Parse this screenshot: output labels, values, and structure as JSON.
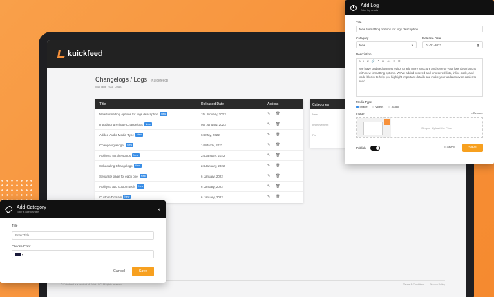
{
  "app": {
    "logo_text": "kuickfeed",
    "page_title": "Changelogs / Logs",
    "page_title_suffix": "(Kuickfeed)",
    "page_subtitle": "Manage Your Logs",
    "footer_copyright": "© Kuickfeed is a product of Kuick LLC. All rights reserved.",
    "footer_links": [
      "Terms & Conditions",
      "Privacy Policy"
    ]
  },
  "table": {
    "headers": [
      "Title",
      "Released Date",
      "Actions"
    ],
    "rows": [
      {
        "title": "New formatting options for logs description",
        "badge": "New",
        "date": "15, January, 2023"
      },
      {
        "title": "Introducing Private Changelogs",
        "badge": "New",
        "date": "05, January, 2023"
      },
      {
        "title": "Added Audio Media Type",
        "badge": "New",
        "date": "04 May, 2022"
      },
      {
        "title": "Changelog widget",
        "badge": "New",
        "date": "14 March, 2022"
      },
      {
        "title": "Ability to set the status",
        "badge": "New",
        "date": "24 January, 2022"
      },
      {
        "title": "Scheduling Changelogs",
        "badge": "New",
        "date": "24 January, 2022"
      },
      {
        "title": "Separate page for each one",
        "badge": "New",
        "date": "6 January, 2022"
      },
      {
        "title": "Ability to add custom tools",
        "badge": "New",
        "date": "6 January, 2022"
      },
      {
        "title": "Custom Domain",
        "badge": "New",
        "date": "6 January, 2022"
      }
    ]
  },
  "categories": {
    "header": "Categories",
    "items": [
      "New",
      "Improvement",
      "Fix"
    ]
  },
  "add_log": {
    "title": "Add Log",
    "subtitle": "Enter log details",
    "title_label": "Title",
    "title_value": "New formatting options for logs description",
    "category_label": "Category",
    "category_value": "New",
    "release_label": "Release Date",
    "release_value": "01-01-2023",
    "description_label": "Description",
    "description_text": "We have updated our text editor to add more structure and style to your logs descriptions with new formatting options. We've added ordered and unordered lists, inline code, and code blocks to help you highlight important details and make your updates even easier to read.",
    "toolbar": [
      "B",
      "I",
      "U",
      "🔗",
      "❝",
      "H",
      "</>",
      "≡",
      "☰"
    ],
    "media_label": "Media Type",
    "media_options": [
      "Image",
      "Videos",
      "Audio"
    ],
    "image_label": "Image",
    "remove_label": "× Remove",
    "drop_text": "Drop or Upload the Files",
    "publish_label": "Publish",
    "cancel_label": "Cancel",
    "save_label": "Save"
  },
  "add_category": {
    "title": "Add Category",
    "subtitle": "Enter a category title",
    "title_label": "Title",
    "title_placeholder": "Enter Title",
    "color_label": "Choose Color",
    "cancel_label": "Cancel",
    "save_label": "Save"
  },
  "colors": {
    "accent": "#f7a01f",
    "badge": "#3a8ee6",
    "dark": "#111111"
  }
}
